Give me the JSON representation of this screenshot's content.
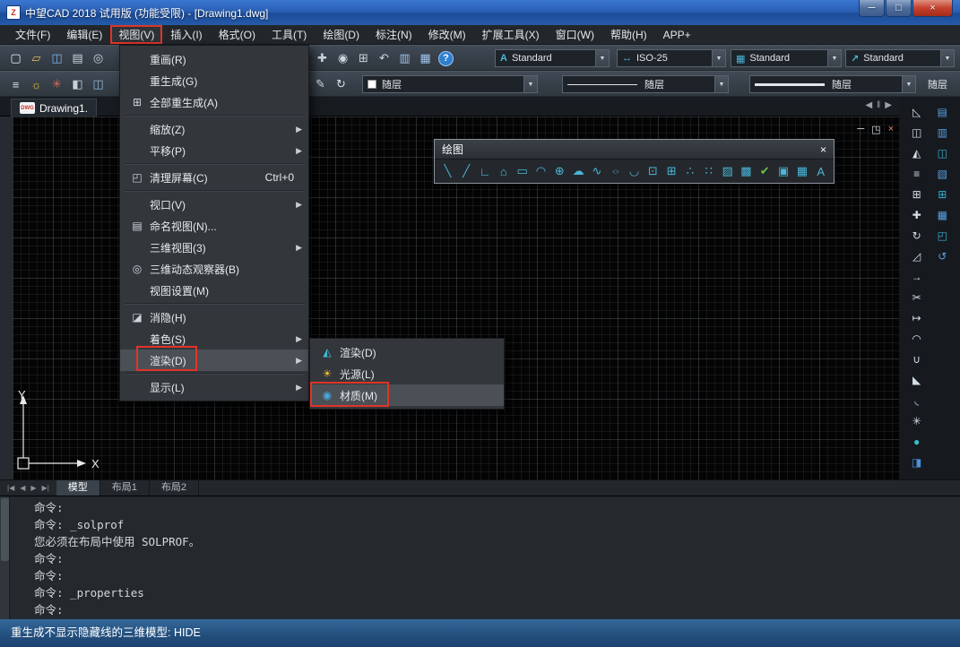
{
  "titlebar": {
    "title": "中望CAD 2018 试用版 (功能受限) - [Drawing1.dwg]",
    "app_icon_text": "Z",
    "minimize": "─",
    "maximize": "□",
    "close": "×"
  },
  "menubar": {
    "items": [
      {
        "name": "file",
        "label": "文件(F)"
      },
      {
        "name": "edit",
        "label": "编辑(E)"
      },
      {
        "name": "view",
        "label": "视图(V)",
        "highlighted": true
      },
      {
        "name": "insert",
        "label": "插入(I)"
      },
      {
        "name": "format",
        "label": "格式(O)"
      },
      {
        "name": "tools",
        "label": "工具(T)"
      },
      {
        "name": "draw",
        "label": "绘图(D)"
      },
      {
        "name": "dimension",
        "label": "标注(N)"
      },
      {
        "name": "modify",
        "label": "修改(M)"
      },
      {
        "name": "express",
        "label": "扩展工具(X)"
      },
      {
        "name": "window",
        "label": "窗口(W)"
      },
      {
        "name": "help",
        "label": "帮助(H)"
      },
      {
        "name": "app-plus",
        "label": "APP+"
      }
    ]
  },
  "toolbar1": {
    "left_icons": [
      "new-icon",
      "open-icon",
      "save-icon",
      "print-icon",
      "preview-icon"
    ],
    "mid_icons": [
      "pan-icon",
      "zoom-realtime-icon",
      "zoom-window-icon",
      "zoom-previous-icon",
      "properties-icon",
      "designcenter-icon",
      "help-icon"
    ],
    "combos": [
      {
        "name": "text-style-combo",
        "icon": "text-style-icon",
        "value": "Standard"
      },
      {
        "name": "dim-style-combo",
        "icon": "dim-style-icon",
        "value": "ISO-25"
      },
      {
        "name": "table-style-combo",
        "icon": "table-style-icon",
        "value": "Standard"
      },
      {
        "name": "mleader-style-combo",
        "icon": "mleader-style-icon",
        "value": "Standard"
      }
    ]
  },
  "toolbar2": {
    "left_icons": [
      "layer-properties-icon",
      "layer-on-icon",
      "layer-freeze-icon",
      "layer-lock-icon",
      "layer-states-icon"
    ],
    "mid_icons": [
      "match-properties-icon",
      "regen-icon"
    ],
    "combos": [
      {
        "name": "color-combo",
        "type": "color",
        "value": "随层"
      },
      {
        "name": "linetype-combo",
        "type": "linetype",
        "value": "随层"
      },
      {
        "name": "lineweight-combo",
        "type": "lineweight",
        "value": "随层"
      },
      {
        "name": "plotstyle-combo",
        "type": "partial",
        "value": "随层"
      }
    ]
  },
  "doc_header": {
    "badge": "DWG",
    "tab_label": "Drawing1.",
    "nav": [
      "◀",
      "‖",
      "▶"
    ]
  },
  "child_controls": {
    "minimize": "─",
    "restore": "◳",
    "close": "×"
  },
  "ucs": {
    "x_label": "X",
    "y_label": "Y"
  },
  "draw_palette": {
    "title": "绘图",
    "close": "×",
    "icons": [
      "line-icon",
      "xline-icon",
      "polyline-icon",
      "polygon-icon",
      "rectangle-icon",
      "arc-icon",
      "circle-icon",
      "revcloud-icon",
      "spline-icon",
      "ellipse-icon",
      "ellipse-arc-icon",
      "insert-block-icon",
      "make-block-icon",
      "point-icon",
      "divide-icon",
      "hatch-icon",
      "gradient-icon",
      "boundary-icon",
      "region-icon",
      "table-icon",
      "mtext-icon"
    ]
  },
  "right_panel": {
    "col1": [
      "erase-icon",
      "copy-icon",
      "mirror-icon",
      "offset-icon",
      "array-icon",
      "move-icon",
      "rotate-icon",
      "scale-icon",
      "stretch-icon",
      "trim-icon",
      "extend-icon",
      "break-icon",
      "join-icon",
      "chamfer-icon",
      "fillet-icon",
      "explode-icon",
      "render-ball-icon",
      "material-lib-icon"
    ],
    "col2": [
      "properties-palette-icon",
      "toolpalette-icon",
      "sheetset-icon",
      "markup-icon",
      "quickcalc-icon",
      "measure-icon",
      "paste-block-icon",
      "undo-view-icon"
    ]
  },
  "view_menu": {
    "items": [
      {
        "name": "redraw",
        "label": "重画(R)"
      },
      {
        "name": "regen",
        "label": "重生成(G)"
      },
      {
        "name": "regen-all",
        "label": "全部重生成(A)",
        "icon": "regen-all-icon"
      },
      {
        "sep": true
      },
      {
        "name": "zoom",
        "label": "缩放(Z)",
        "arrow": true
      },
      {
        "name": "pan",
        "label": "平移(P)",
        "arrow": true
      },
      {
        "sep": true
      },
      {
        "name": "clean-screen",
        "label": "清理屏幕(C)",
        "icon": "clean-screen-icon",
        "shortcut": "Ctrl+0"
      },
      {
        "sep": true
      },
      {
        "name": "viewports",
        "label": "视口(V)",
        "arrow": true
      },
      {
        "name": "named-views",
        "label": "命名视图(N)...",
        "icon": "named-view-icon"
      },
      {
        "name": "3d-views",
        "label": "三维视图(3)",
        "arrow": true
      },
      {
        "name": "3d-orbit",
        "label": "三维动态观察器(B)",
        "icon": "orbit-icon"
      },
      {
        "name": "view-settings",
        "label": "视图设置(M)"
      },
      {
        "sep": true
      },
      {
        "name": "hide",
        "label": "消隐(H)",
        "icon": "hide-icon"
      },
      {
        "name": "shade",
        "label": "着色(S)",
        "arrow": true
      },
      {
        "name": "render",
        "label": "渲染(D)",
        "arrow": true,
        "highlighted": true
      },
      {
        "sep": true
      },
      {
        "name": "display",
        "label": "显示(L)",
        "arrow": true
      }
    ]
  },
  "render_submenu": {
    "items": [
      {
        "name": "render",
        "label": "渲染(D)",
        "icon": "render-icon"
      },
      {
        "name": "light",
        "label": "光源(L)",
        "icon": "light-icon"
      },
      {
        "name": "material",
        "label": "材质(M)",
        "icon": "material-icon",
        "highlighted": true
      }
    ]
  },
  "tabbar": {
    "nav": [
      "|◀",
      "◀",
      "▶",
      "▶|"
    ],
    "tabs": [
      {
        "label": "模型",
        "active": true
      },
      {
        "label": "布局1",
        "active": false
      },
      {
        "label": "布局2",
        "active": false
      }
    ]
  },
  "command": {
    "lines": [
      "命令:",
      "命令: _solprof",
      "您必须在布局中使用 SOLPROF。",
      "命令:",
      "命令:",
      "命令: _properties",
      "命令:"
    ]
  },
  "statusbar": {
    "text": "重生成不显示隐藏线的三维模型: HIDE"
  },
  "annotations": {
    "color": "#e03428"
  }
}
